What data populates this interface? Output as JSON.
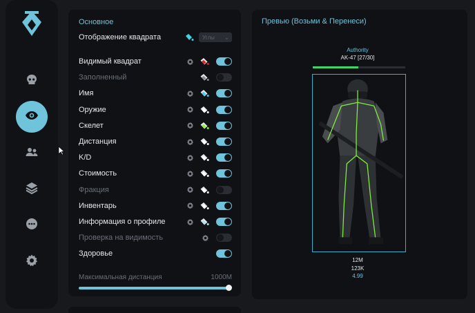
{
  "colors": {
    "accent": "#6fc4db",
    "bg": "#17191d",
    "panel": "#0f1115",
    "health": "#3ed66a",
    "red_bucket": "#e02424",
    "cyan_bucket": "#3fd0ea",
    "green_bucket": "#8ff03a"
  },
  "sidebar": {
    "items": [
      {
        "icon": "skull-icon",
        "active": false
      },
      {
        "icon": "eye-icon",
        "active": true
      },
      {
        "icon": "users-icon",
        "active": false
      },
      {
        "icon": "layers-icon",
        "active": false
      },
      {
        "icon": "chat-icon",
        "active": false
      },
      {
        "icon": "gear-icon",
        "active": false
      }
    ]
  },
  "settings": {
    "section_title": "Основное",
    "box_display": {
      "label": "Отображение квадрата",
      "select_value": "Углы"
    },
    "rows": [
      {
        "label": "Видимый квадрат",
        "enabled": true,
        "bucket_color": "#e02424",
        "gear": true
      },
      {
        "label": "Заполненный",
        "enabled": false,
        "bucket_color": "#8a8f98",
        "gear": false
      },
      {
        "label": "Имя",
        "enabled": true,
        "bucket_color": "#3fd0ea",
        "gear": true
      },
      {
        "label": "Оружие",
        "enabled": true,
        "bucket_color": "#ffffff",
        "gear": true
      },
      {
        "label": "Скелет",
        "enabled": true,
        "bucket_color": "#8ff03a",
        "gear": true
      },
      {
        "label": "Дистанция",
        "enabled": true,
        "bucket_color": "#ffffff",
        "gear": true
      },
      {
        "label": "K/D",
        "enabled": true,
        "bucket_color": "#ffffff",
        "gear": true
      },
      {
        "label": "Стоимость",
        "enabled": true,
        "bucket_color": "#ffffff",
        "gear": true
      },
      {
        "label": "Фракция",
        "enabled": false,
        "bucket_color": "#ffffff",
        "gear": true
      },
      {
        "label": "Инвентарь",
        "enabled": true,
        "bucket_color": "#ffffff",
        "gear": true
      },
      {
        "label": "Информация о профиле",
        "enabled": true,
        "bucket_color": "#aee4f0",
        "gear": true
      },
      {
        "label": "Проверка на видимость",
        "enabled": false,
        "bucket_color": null,
        "gear": true
      },
      {
        "label": "Здоровье",
        "enabled": true,
        "bucket_color": null,
        "gear": false
      }
    ],
    "max_distance": {
      "label": "Максимальная дистанция",
      "value": "1000M",
      "fraction": 1.0
    }
  },
  "preview": {
    "title": "Превью (Возьми & Перенеси)",
    "player_name": "Authority",
    "weapon": "AK-47 [27/30]",
    "health_fraction": 0.49,
    "distance": "12M",
    "value": "123K",
    "kd": "4.99"
  }
}
